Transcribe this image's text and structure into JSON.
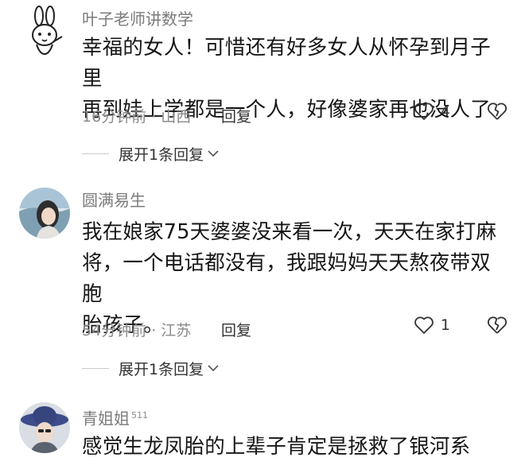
{
  "comments": [
    {
      "username": "叶子老师讲数学",
      "badge": "",
      "avatar": "rabbit-avatar-icon",
      "lines": [
        "幸福的女人！可惜还有好多女人从怀孕到月子里",
        "再到娃上学都是一个人，好像婆家再也没人了"
      ],
      "meta": "16分钟前 · 山西",
      "reply_label": "回复",
      "likes": "4",
      "expand_label": "展开1条回复"
    },
    {
      "username": "圆满易生",
      "badge": "",
      "avatar": "woman-photo-avatar",
      "lines": [
        "我在娘家75天婆婆没来看一次，天天在家打麻",
        "将，一个电话都没有，我跟妈妈天天熬夜带双胞",
        "胎孩子。"
      ],
      "meta": "54分钟前 · 江苏",
      "reply_label": "回复",
      "likes": "1",
      "expand_label": "展开1条回复"
    },
    {
      "username": "青姐姐",
      "badge": "511",
      "avatar": "hat-woman-photo-avatar",
      "lines": [
        "感觉生龙凤胎的上辈子肯定是拯救了银河系"
      ]
    }
  ],
  "colors": {
    "username": "#7b7b7b",
    "text": "#161616",
    "meta": "#8a8a8a",
    "background": "#ffffff"
  },
  "icons": [
    "like-heart-icon",
    "dislike-broken-heart-icon",
    "chevron-down-icon"
  ]
}
